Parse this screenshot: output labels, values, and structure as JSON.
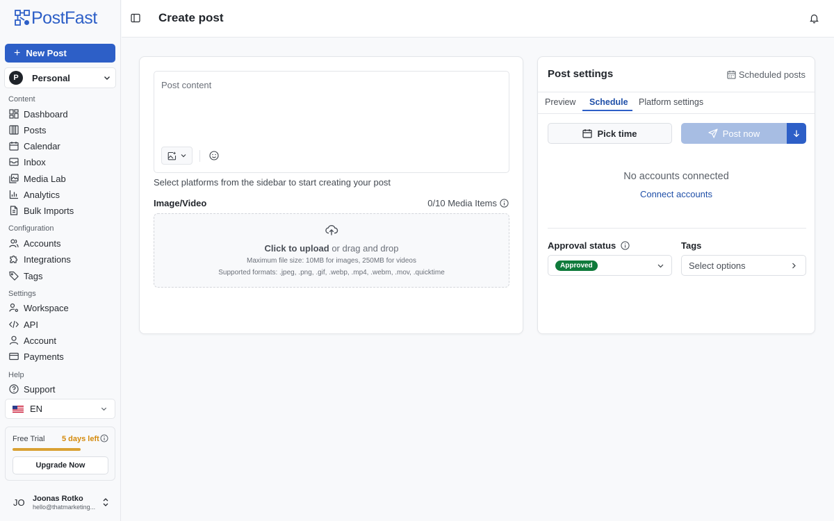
{
  "sidebar": {
    "logo_text": "PostFast",
    "new_post_label": "New Post",
    "workspace": {
      "initial": "P",
      "name": "Personal"
    },
    "sections": [
      {
        "label": "Content",
        "items": [
          "Dashboard",
          "Posts",
          "Calendar",
          "Inbox",
          "Media Lab",
          "Analytics",
          "Bulk Imports"
        ]
      },
      {
        "label": "Configuration",
        "items": [
          "Accounts",
          "Integrations",
          "Tags"
        ]
      },
      {
        "label": "Settings",
        "items": [
          "Workspace",
          "API",
          "Account",
          "Payments"
        ]
      },
      {
        "label": "Help",
        "items": [
          "Support"
        ]
      }
    ],
    "language": {
      "code": "EN",
      "flag": "us-flag"
    },
    "trial": {
      "label": "Free Trial",
      "days_left": "5 days left",
      "progress": 0.71,
      "upgrade_label": "Upgrade Now"
    },
    "user": {
      "initials": "JO",
      "name": "Joonas Rotko",
      "email": "hello@thatmarketing..."
    }
  },
  "header": {
    "title": "Create post"
  },
  "editor": {
    "placeholder": "Post content",
    "hint": "Select platforms from the sidebar to start creating your post",
    "media_label": "Image/Video",
    "media_count": "0/10 Media Items",
    "dropzone": {
      "upload_action": "Click to upload",
      "upload_rest": " or drag and drop",
      "max_size": "Maximum file size: 10MB for images, 250MB for videos",
      "formats": "Supported formats: .jpeg, .png, .gif, .webp, .mp4, .webm, .mov, .quicktime"
    }
  },
  "post_settings": {
    "title": "Post settings",
    "scheduled_link": "Scheduled posts",
    "tabs": [
      "Preview",
      "Schedule",
      "Platform settings"
    ],
    "active_tab": "Schedule",
    "pick_time_label": "Pick time",
    "post_now_label": "Post now",
    "no_accounts": "No accounts connected",
    "connect_link": "Connect accounts",
    "approval_label": "Approval status",
    "approval_value": "Approved",
    "tags_label": "Tags",
    "tags_placeholder": "Select options"
  },
  "colors": {
    "primary": "#2d5fc7",
    "primary_disabled": "#a7bde3",
    "approved": "#0f7a3b",
    "trial_accent": "#d48a0c"
  }
}
